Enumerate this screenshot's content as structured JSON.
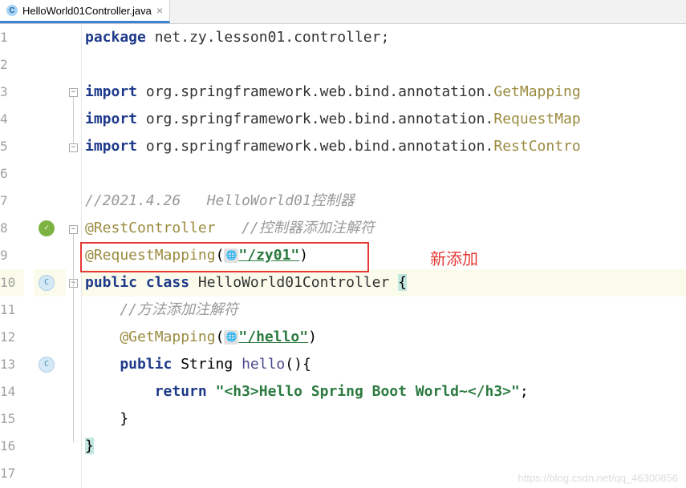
{
  "tab": {
    "filename": "HelloWorld01Controller.java",
    "iconLetter": "C"
  },
  "annotation_label": "新添加",
  "watermark": "https://blog.csdn.net/qq_46300856",
  "lines": {
    "n1": "1",
    "n2": "2",
    "n3": "3",
    "n4": "4",
    "n5": "5",
    "n6": "6",
    "n7": "7",
    "n8": "8",
    "n9": "9",
    "n10": "10",
    "n11": "11",
    "n12": "12",
    "n13": "13",
    "n14": "14",
    "n15": "15",
    "n16": "16",
    "n17": "17"
  },
  "code": {
    "l1_kw": "package",
    "l1_pkg": " net.zy.lesson01.controller;",
    "l3_kw": "import",
    "l3_pkg": " org.springframework.web.bind.annotation.",
    "l3_cls": "GetMapping",
    "l4_kw": "import",
    "l4_pkg": " org.springframework.web.bind.annotation.",
    "l4_cls": "RequestMap",
    "l5_kw": "import",
    "l5_pkg": " org.springframework.web.bind.annotation.",
    "l5_cls": "RestContro",
    "l7_comment": "//2021.4.26   HelloWorld01控制器",
    "l8_ann": "@RestController",
    "l8_comment": "   //控制器添加注解符",
    "l9_ann": "@RequestMapping",
    "l9_paren1": "(",
    "l9_str": "\"/zy01\"",
    "l9_paren2": ")",
    "l10_kw1": "public",
    "l10_kw2": " class ",
    "l10_cls": "HelloWorld01Controller ",
    "l10_brace": "{",
    "l11_comment": "    //方法添加注解符",
    "l12_ann": "    @GetMapping",
    "l12_paren1": "(",
    "l12_str": "\"/hello\"",
    "l12_paren2": ")",
    "l13_kw": "    public",
    "l13_type": " String ",
    "l13_method": "hello",
    "l13_rest": "(){",
    "l14_kw": "        return ",
    "l14_str": "\"<h3>Hello Spring Boot World~</h3>\"",
    "l14_semi": ";",
    "l15": "    }",
    "l16_brace": "}"
  }
}
